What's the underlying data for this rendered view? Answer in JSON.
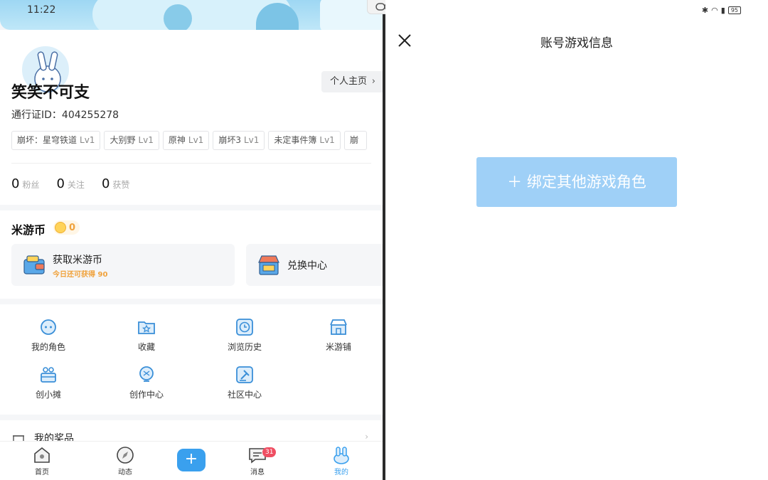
{
  "status": {
    "time": "11:22",
    "battery": "95"
  },
  "profile": {
    "home_label": "个人主页",
    "username": "笑笑不可支",
    "pass_id": "通行证ID：404255278",
    "tags": [
      {
        "name": "崩坏：星穹铁道",
        "level": "Lv1"
      },
      {
        "name": "大别野",
        "level": "Lv1"
      },
      {
        "name": "原神",
        "level": "Lv1"
      },
      {
        "name": "崩坏3",
        "level": "Lv1"
      },
      {
        "name": "未定事件簿",
        "level": "Lv1"
      },
      {
        "name": "崩",
        "level": ""
      }
    ],
    "stats": [
      {
        "value": "0",
        "label": "粉丝"
      },
      {
        "value": "0",
        "label": "关注"
      },
      {
        "value": "0",
        "label": "获赞"
      }
    ]
  },
  "coins": {
    "title": "米游币",
    "count": "0",
    "get_title": "获取米游币",
    "get_sub": "今日还可获得 90",
    "exchange_title": "兑换中心"
  },
  "grid": [
    {
      "label": "我的角色",
      "icon": "character-icon"
    },
    {
      "label": "收藏",
      "icon": "star-folder-icon"
    },
    {
      "label": "浏览历史",
      "icon": "clock-icon"
    },
    {
      "label": "米游铺",
      "icon": "shop-icon"
    },
    {
      "label": "创小摊",
      "icon": "stall-icon"
    },
    {
      "label": "创作中心",
      "icon": "bulb-icon"
    },
    {
      "label": "社区中心",
      "icon": "gavel-icon"
    }
  ],
  "list": {
    "first_item": "我的奖品"
  },
  "tabs": [
    {
      "label": "首页",
      "icon": "home-icon"
    },
    {
      "label": "动态",
      "icon": "compass-icon"
    },
    {
      "label": "",
      "icon": "plus-icon"
    },
    {
      "label": "消息",
      "icon": "message-icon",
      "badge": "31"
    },
    {
      "label": "我的",
      "icon": "bunny-icon"
    }
  ],
  "right": {
    "title": "账号游戏信息",
    "bind_button": "＋ 绑定其他游戏角色"
  },
  "colors": {
    "accent": "#3aa0ee",
    "bind_button": "#9fd0f7",
    "badge": "#ef4e62",
    "coin_text": "#f0a23c"
  }
}
